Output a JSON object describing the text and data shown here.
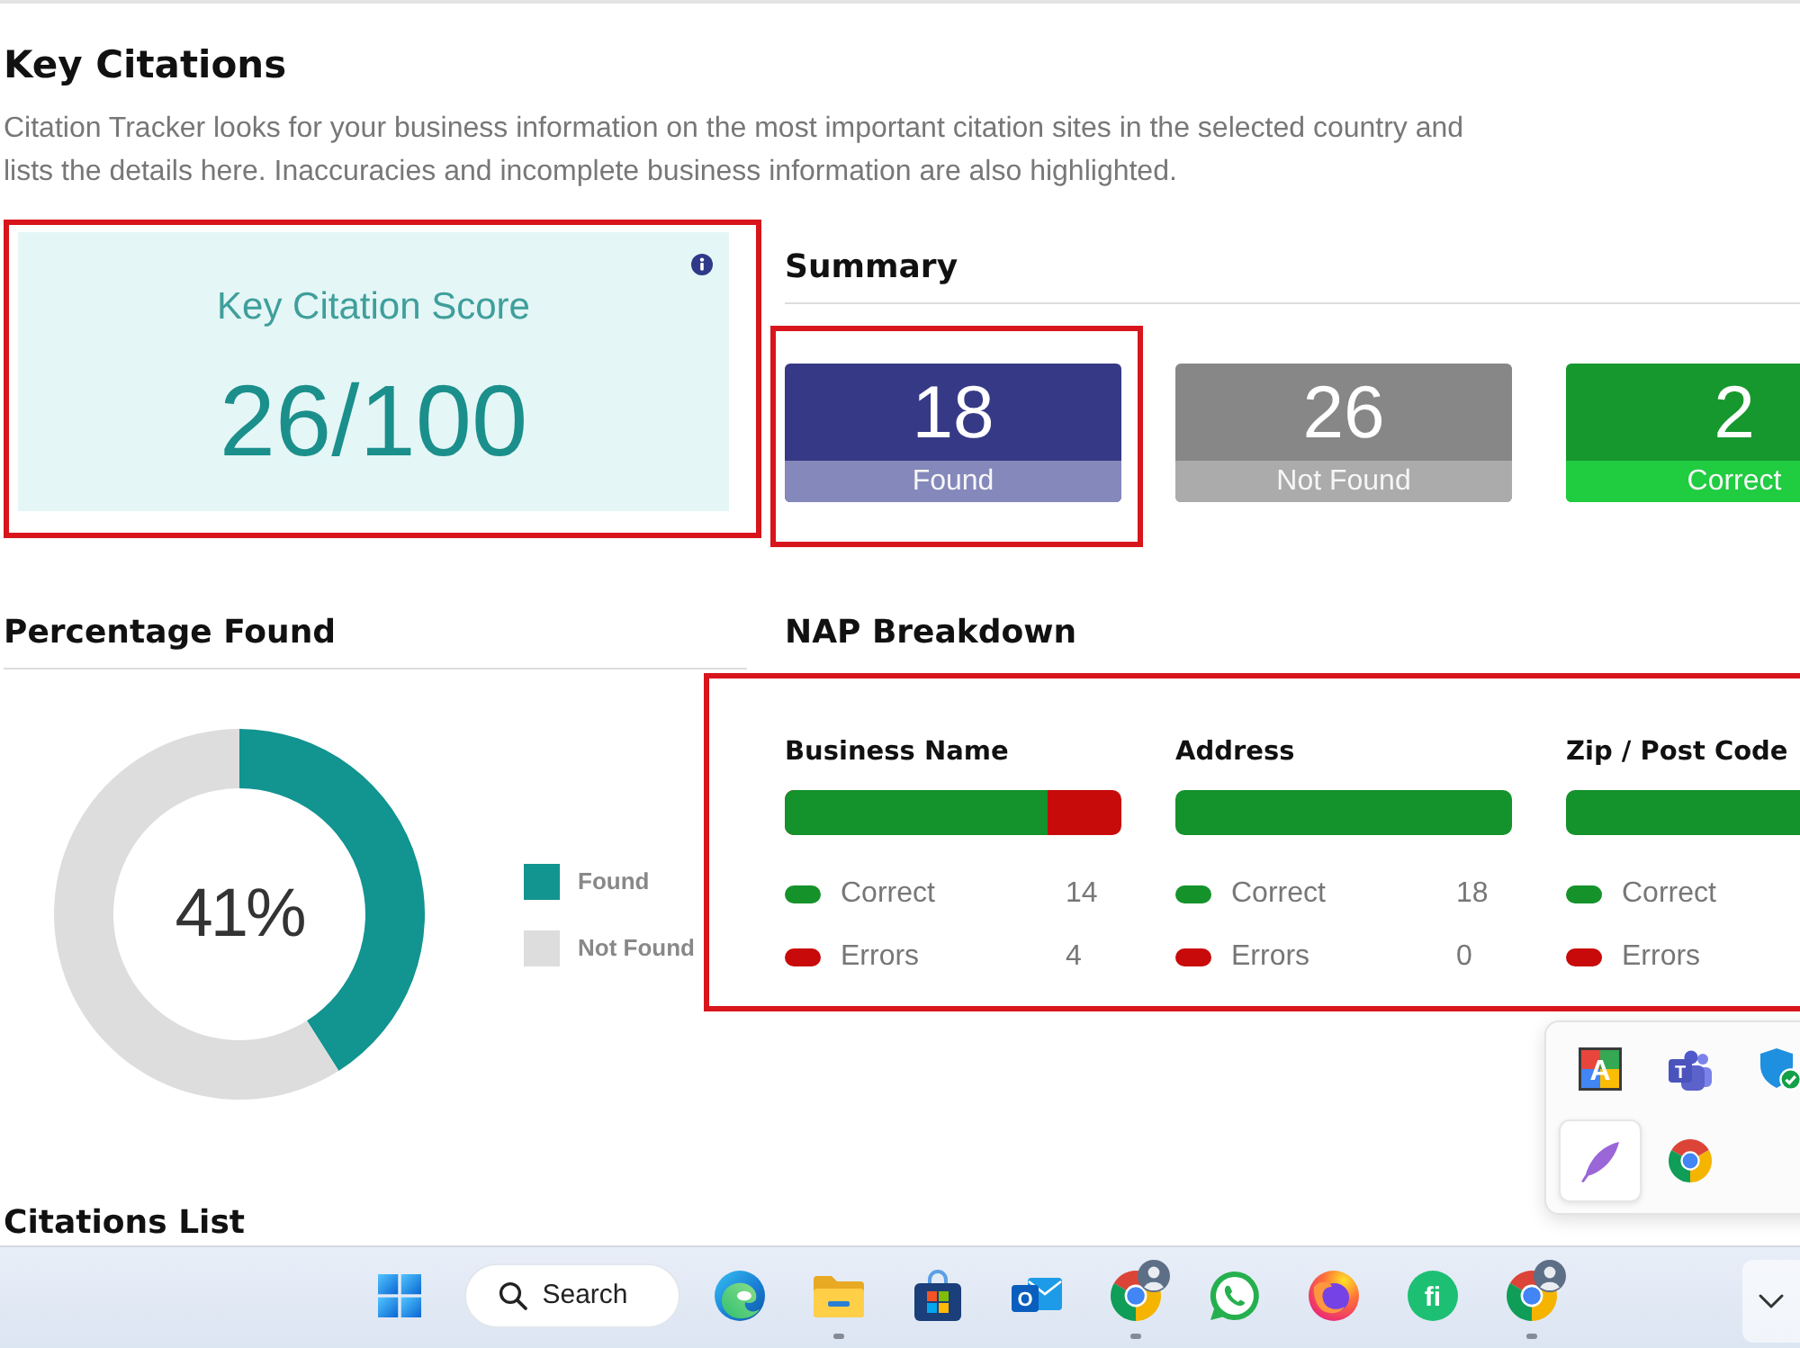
{
  "page": {
    "title": "Key Citations",
    "description": "Citation Tracker looks for your business information on the most important citation sites in the selected country and lists the details here. Inaccuracies and incomplete business information are also highlighted."
  },
  "score_card": {
    "label": "Key Citation Score",
    "value": "26/100",
    "highlighted": true
  },
  "summary": {
    "title": "Summary",
    "tiles": [
      {
        "kind": "found",
        "value": "18",
        "label": "Found",
        "highlighted": true
      },
      {
        "kind": "not-found",
        "value": "26",
        "label": "Not Found",
        "highlighted": false
      },
      {
        "kind": "correct",
        "value": "2",
        "label": "Correct",
        "highlighted": false
      }
    ]
  },
  "percentage_found": {
    "title": "Percentage Found",
    "center_label": "41%",
    "chart_data": {
      "type": "donut",
      "categories": [
        "Found",
        "Not Found"
      ],
      "values": [
        41,
        59
      ]
    },
    "legend": [
      {
        "color": "#129490"
      },
      {
        "color": "#dddddd"
      }
    ]
  },
  "nap_breakdown": {
    "title": "NAP Breakdown",
    "highlighted": true,
    "items": [
      {
        "name": "Business Name",
        "level": 0.78,
        "rows": [
          {
            "kind": "correct",
            "label": "Correct",
            "count": "14"
          },
          {
            "kind": "errors",
            "label": "Errors",
            "count": "4"
          }
        ]
      },
      {
        "name": "Address",
        "level": 1,
        "rows": [
          {
            "kind": "correct",
            "label": "Correct",
            "count": "18"
          },
          {
            "kind": "errors",
            "label": "Errors",
            "count": "0"
          }
        ]
      },
      {
        "name": "Zip / Post Code",
        "level": 1,
        "rows": [
          {
            "kind": "correct",
            "label": "Correct"
          },
          {
            "kind": "errors",
            "label": "Errors"
          }
        ]
      }
    ]
  },
  "citations_list": {
    "title": "Citations List"
  },
  "tray": {
    "items": [
      {
        "kind": "letter-tile",
        "label": "A",
        "selected": false
      },
      {
        "kind": "people-tile",
        "label": "T",
        "selected": false
      },
      {
        "kind": "shield",
        "selected": false
      },
      {
        "kind": "feather",
        "selected": true
      },
      {
        "kind": "chrome",
        "selected": false
      }
    ]
  },
  "taskbar": {
    "apps": [
      {
        "kind": "start",
        "running": false
      },
      {
        "kind": "search",
        "label": "Search",
        "running": false
      },
      {
        "kind": "edge",
        "running": false
      },
      {
        "kind": "folder",
        "running": true
      },
      {
        "kind": "store",
        "running": false
      },
      {
        "kind": "mail",
        "label": "O",
        "running": false
      },
      {
        "kind": "chrome-profile",
        "running": true
      },
      {
        "kind": "chat",
        "running": false
      },
      {
        "kind": "firefox",
        "running": false
      },
      {
        "kind": "letter-logo",
        "label": "fi",
        "running": false
      },
      {
        "kind": "chrome-profile",
        "running": true
      }
    ]
  }
}
